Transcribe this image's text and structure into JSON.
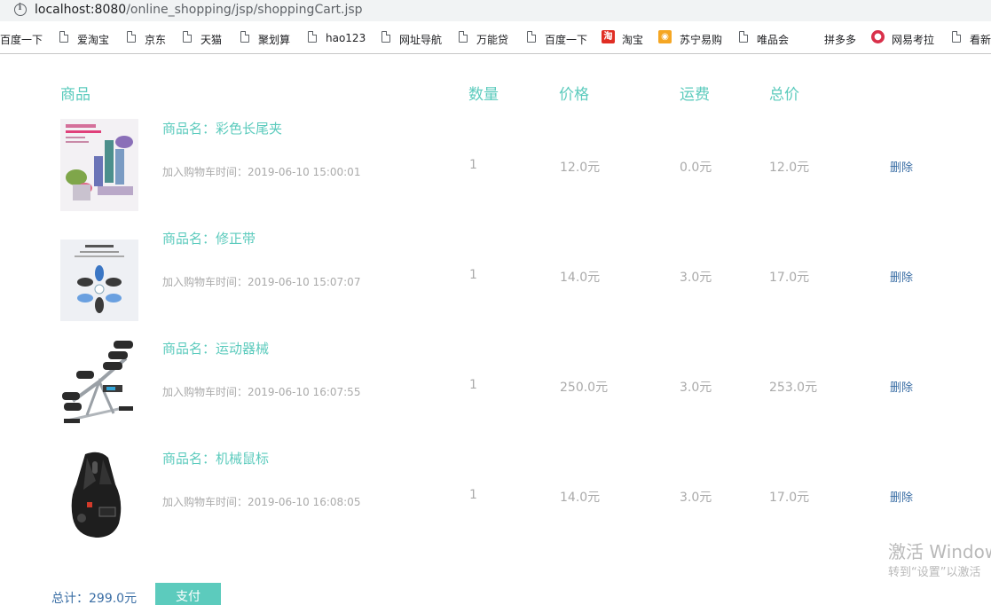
{
  "browser": {
    "url_host": "localhost:8080",
    "url_path": "/online_shopping/jsp/shoppingCart.jsp",
    "bookmarks": [
      "百度一下",
      "爱淘宝",
      "京东",
      "天猫",
      "聚划算",
      "hao123",
      "网址导航",
      "万能贷",
      "百度一下",
      "淘宝",
      "苏宁易购",
      "唯品会",
      "拼多多",
      "网易考拉",
      "看新"
    ]
  },
  "cart": {
    "headers": {
      "product": "商品",
      "quantity": "数量",
      "price": "价格",
      "shipping": "运费",
      "total": "总价"
    },
    "items": [
      {
        "name": "商品名：彩色长尾夹",
        "added": "加入购物车时间：2019-06-10 15:00:01",
        "quantity": "1",
        "price": "12.0元",
        "shipping": "0.0元",
        "total": "12.0元",
        "delete": "删除"
      },
      {
        "name": "商品名：修正带",
        "added": "加入购物车时间：2019-06-10 15:07:07",
        "quantity": "1",
        "price": "14.0元",
        "shipping": "3.0元",
        "total": "17.0元",
        "delete": "删除"
      },
      {
        "name": "商品名：运动器械",
        "added": "加入购物车时间：2019-06-10 16:07:55",
        "quantity": "1",
        "price": "250.0元",
        "shipping": "3.0元",
        "total": "253.0元",
        "delete": "删除"
      },
      {
        "name": "商品名：机械鼠标",
        "added": "加入购物车时间：2019-06-10 16:08:05",
        "quantity": "1",
        "price": "14.0元",
        "shipping": "3.0元",
        "total": "17.0元",
        "delete": "删除"
      }
    ],
    "grand_total": "总计：299.0元",
    "pay_label": "支付"
  },
  "watermark": {
    "line1": "激活 Window",
    "line2": "转到“设置”以激活"
  },
  "colors": {
    "accent": "#5ccbbd",
    "link": "#3a6ea5",
    "muted": "#aaaaaa"
  }
}
